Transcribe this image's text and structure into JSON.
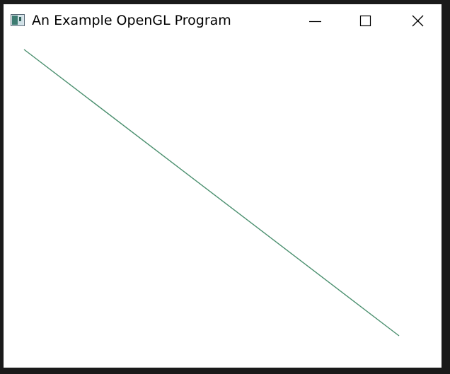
{
  "window": {
    "title": "An Example OpenGL Program"
  },
  "icons": {
    "app": "opengl-app-icon",
    "minimize": "minimize-icon",
    "maximize": "maximize-icon",
    "close": "close-icon"
  },
  "colors": {
    "line": "#4a8f6e",
    "background": "#ffffff",
    "frame": "#1a1a1a"
  },
  "canvas": {
    "content": "single diagonal line from upper-left to lower-right"
  }
}
